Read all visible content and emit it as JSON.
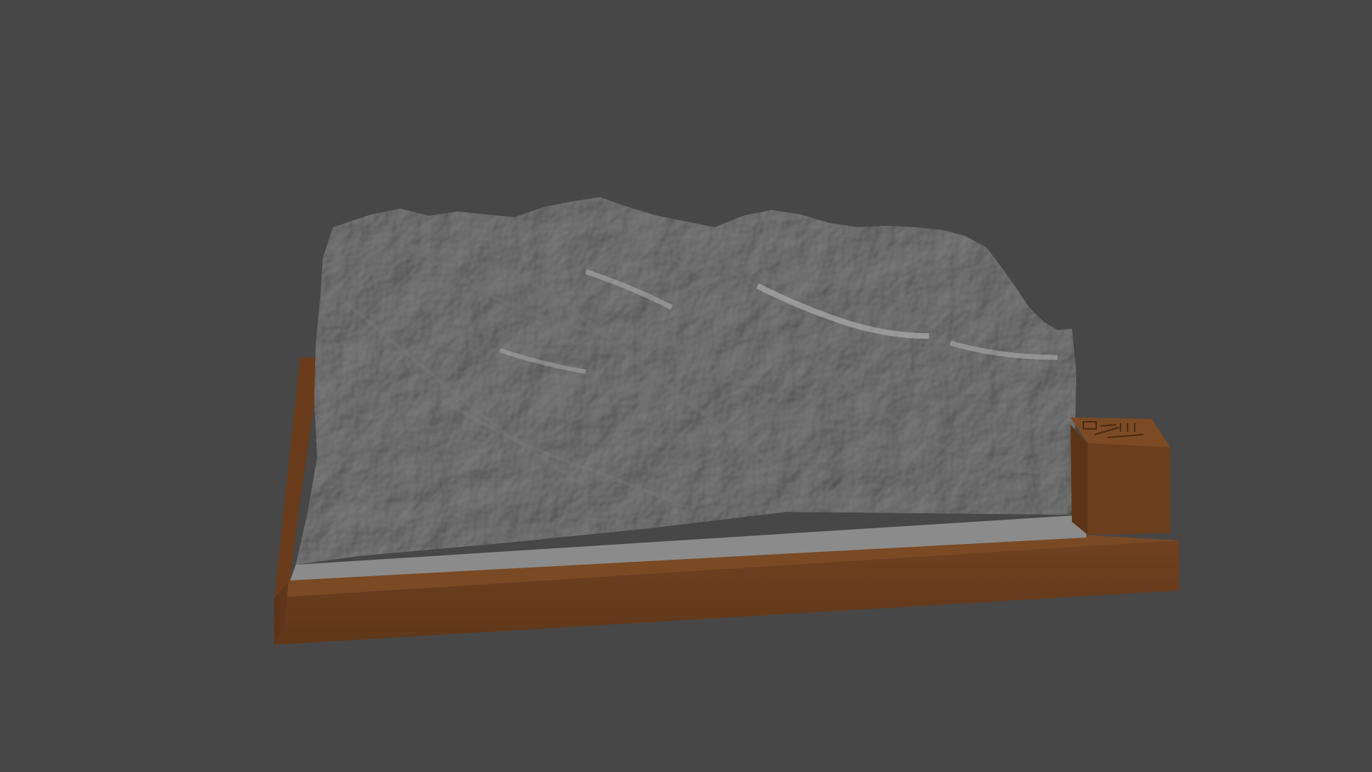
{
  "viewport": {
    "background": "#474747"
  },
  "model": {
    "terrain_color": "#9b9b9b",
    "base_color": "#6b3f1f",
    "plate_color": "#8a8a8a",
    "has_legend_block": true,
    "legend_block_icon": "compass-and-scale-emboss"
  }
}
